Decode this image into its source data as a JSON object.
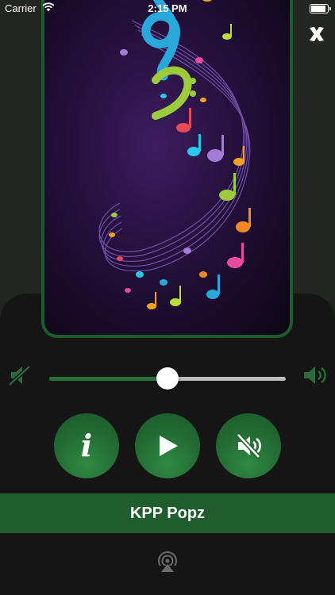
{
  "status_bar": {
    "carrier": "Carrier",
    "time": "2:15 PM",
    "battery_level": 1.0
  },
  "player": {
    "volume": 0.5,
    "station_name": "KPP Popz",
    "buttons": {
      "info": "i"
    }
  },
  "icons": {
    "close": "close-icon",
    "volume_min": "volume-low-icon",
    "volume_max": "volume-high-icon",
    "info": "info-icon",
    "play": "play-icon",
    "mute": "mute-icon",
    "airplay": "airplay-icon",
    "wifi": "wifi-icon",
    "battery": "battery-icon"
  },
  "colors": {
    "accent_green": "#1f5e2c",
    "button_green": "#226a33",
    "background": "#1f221f",
    "panel": "#141514"
  }
}
